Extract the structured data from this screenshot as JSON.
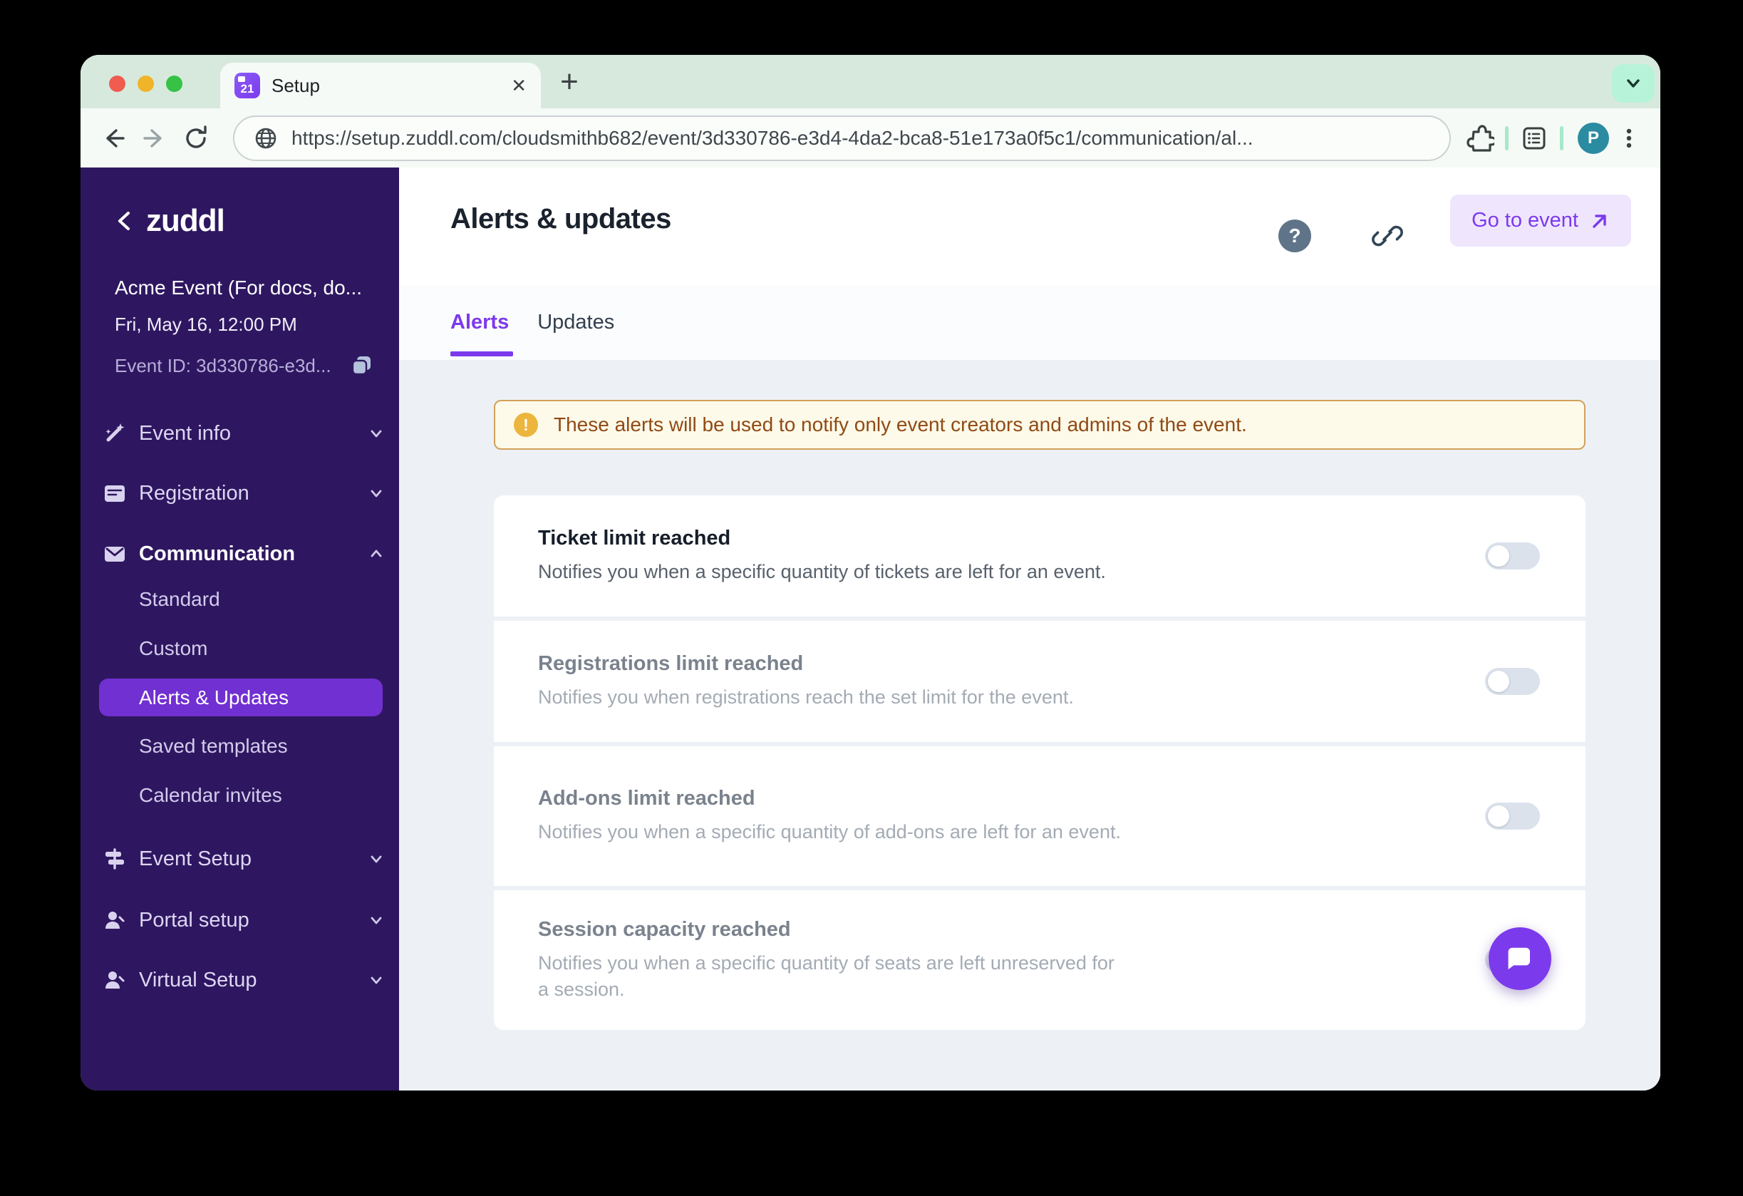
{
  "colors": {
    "accent": "#7c3aed",
    "sidebar_bg": "#2e1760",
    "selected_item_bg": "#7130d1",
    "tabstrip_bg": "#d7e9dd",
    "toolbar_bg": "#f6faf7",
    "content_bg": "#edf1f6",
    "banner_bg": "#fdfae9",
    "banner_border": "#d3a05a",
    "banner_text": "#8f4a16",
    "avatar_bg": "#2b8ba1",
    "toggle_track": "#dbe2ec"
  },
  "browser": {
    "tab": {
      "title": "Setup",
      "favicon_text": "21"
    },
    "url": "https://setup.zuddl.com/cloudsmithb682/event/3d330786-e3d4-4da2-bca8-51e173a0f5c1/communication/al...",
    "new_tab_label": "+",
    "close_tab_label": "✕",
    "avatar_initial": "P"
  },
  "sidebar": {
    "logo_text": "zuddl",
    "event_name": "Acme Event (For docs, do...",
    "event_date": "Fri, May 16, 12:00 PM",
    "event_id": "Event ID: 3d330786-e3d...",
    "items": [
      {
        "label": "Event info"
      },
      {
        "label": "Registration"
      },
      {
        "label": "Communication"
      },
      {
        "label": "Standard"
      },
      {
        "label": "Custom"
      },
      {
        "label": "Alerts & Updates"
      },
      {
        "label": "Saved templates"
      },
      {
        "label": "Calendar invites"
      },
      {
        "label": "Event Setup"
      },
      {
        "label": "Portal setup"
      },
      {
        "label": "Virtual Setup"
      }
    ]
  },
  "main": {
    "title": "Alerts & updates",
    "help_label": "?",
    "go_to_event_label": "Go to event",
    "tabs": [
      {
        "label": "Alerts",
        "active": true
      },
      {
        "label": "Updates",
        "active": false
      }
    ],
    "banner_text": "These alerts will be used to notify only event creators and admins of the event.",
    "banner_icon": "!",
    "alerts": [
      {
        "title": "Ticket limit reached",
        "description": "Notifies you when a specific quantity of tickets are left for an event.",
        "enabled": false
      },
      {
        "title": "Registrations limit reached",
        "description": "Notifies you when registrations reach the set limit for the event.",
        "enabled": false
      },
      {
        "title": "Add-ons limit reached",
        "description": "Notifies you when a specific quantity of add-ons are left for an event.",
        "enabled": false
      },
      {
        "title": "Session capacity reached",
        "description": "Notifies you when a specific quantity of seats are left unreserved for a session.",
        "enabled": false
      }
    ]
  }
}
